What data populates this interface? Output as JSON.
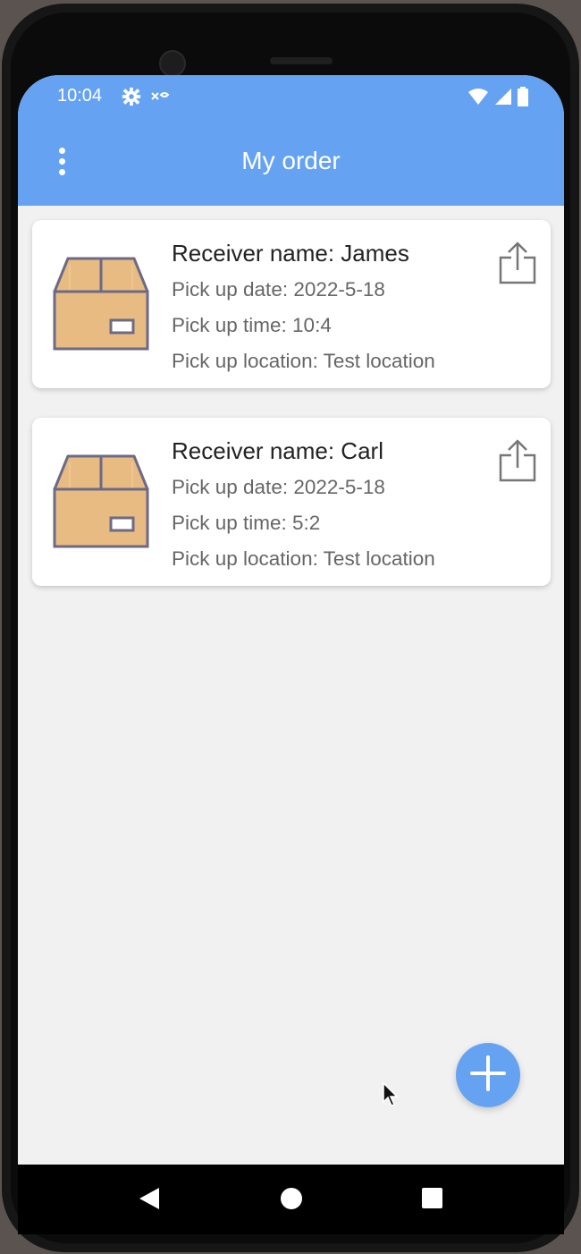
{
  "status_bar": {
    "time": "10:04",
    "icons": [
      "gear-icon",
      "extra-icon",
      "wifi-icon",
      "signal-icon",
      "battery-icon"
    ]
  },
  "app_bar": {
    "title": "My order",
    "menu_icon": "more-vert-icon"
  },
  "orders": [
    {
      "receiver": "Receiver name: James",
      "pickup_date": "Pick up date: 2022-5-18",
      "pickup_time": "Pick up time: 10:4",
      "pickup_location": "Pick up location: Test location",
      "icon": "package-box-icon",
      "action_icon": "share-icon"
    },
    {
      "receiver": "Receiver name: Carl",
      "pickup_date": "Pick up date: 2022-5-18",
      "pickup_time": "Pick up time: 5:2",
      "pickup_location": "Pick up location: Test location",
      "icon": "package-box-icon",
      "action_icon": "share-icon"
    }
  ],
  "fab": {
    "icon": "add-icon"
  },
  "nav_bar": {
    "icons": [
      "back-icon",
      "home-icon",
      "recents-icon"
    ]
  },
  "colors": {
    "primary": "#65a3f2",
    "background": "#f1f1f1",
    "card": "#ffffff",
    "box_fill": "#e8bb82",
    "box_outline": "#6c6a86"
  }
}
